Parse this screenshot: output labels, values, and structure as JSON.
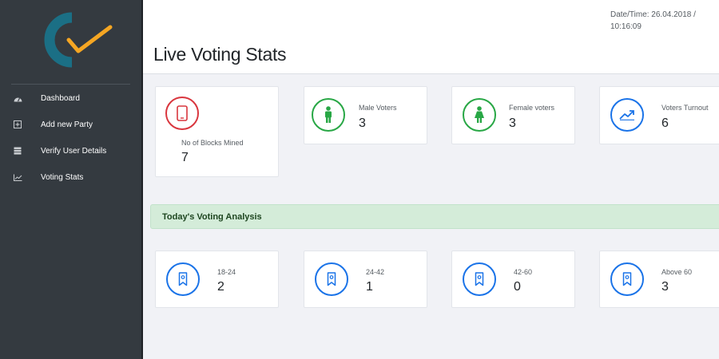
{
  "sidebar": {
    "logo": "app-logo",
    "items": [
      {
        "label": "Dashboard",
        "icon": "dashboard-icon"
      },
      {
        "label": "Add new Party",
        "icon": "plus-square-icon"
      },
      {
        "label": "Verify User Details",
        "icon": "list-icon"
      },
      {
        "label": "Voting Stats",
        "icon": "line-chart-icon"
      }
    ]
  },
  "header": {
    "title": "Live Voting Stats",
    "datetime": "Date/Time: 26.04.2018 / 10:16:09"
  },
  "stats": {
    "blocks": {
      "label": "No of Blocks Mined",
      "value": "7",
      "icon": "mobile-icon",
      "color": "#d9363e"
    },
    "male": {
      "label": "Male Voters",
      "value": "3",
      "icon": "male-icon",
      "color": "#28a745"
    },
    "female": {
      "label": "Female voters",
      "value": "3",
      "icon": "female-icon",
      "color": "#28a745"
    },
    "turnout": {
      "label": "Voters Turnout",
      "value": "6",
      "icon": "trending-up-icon",
      "color": "#1a73e8"
    }
  },
  "analysis": {
    "title": "Today's Voting Analysis",
    "icon": "award-icon",
    "color": "#1a73e8",
    "groups": [
      {
        "label": "18-24",
        "value": "2"
      },
      {
        "label": "24-42",
        "value": "1"
      },
      {
        "label": "42-60",
        "value": "0"
      },
      {
        "label": "Above 60",
        "value": "3"
      }
    ]
  },
  "colors": {
    "sidebar": "#343a40",
    "logo_teal": "#1b6f85",
    "logo_orange": "#f5a623",
    "success_bg": "#d4ecd9"
  }
}
